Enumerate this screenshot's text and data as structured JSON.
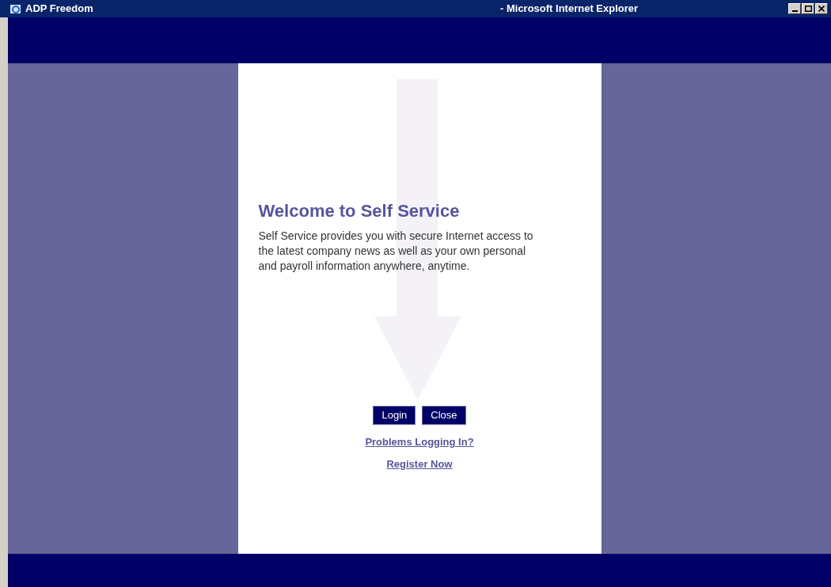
{
  "window": {
    "title": "ADP Freedom",
    "app_title": "- Microsoft Internet Explorer"
  },
  "panel": {
    "heading": "Welcome to Self Service",
    "body": "Self Service provides you with secure Internet access to the latest company news as well as your own personal and payroll information anywhere, anytime.",
    "buttons": [
      "Login",
      "Close"
    ],
    "links": [
      "Problems Logging In?",
      "Register Now"
    ]
  }
}
